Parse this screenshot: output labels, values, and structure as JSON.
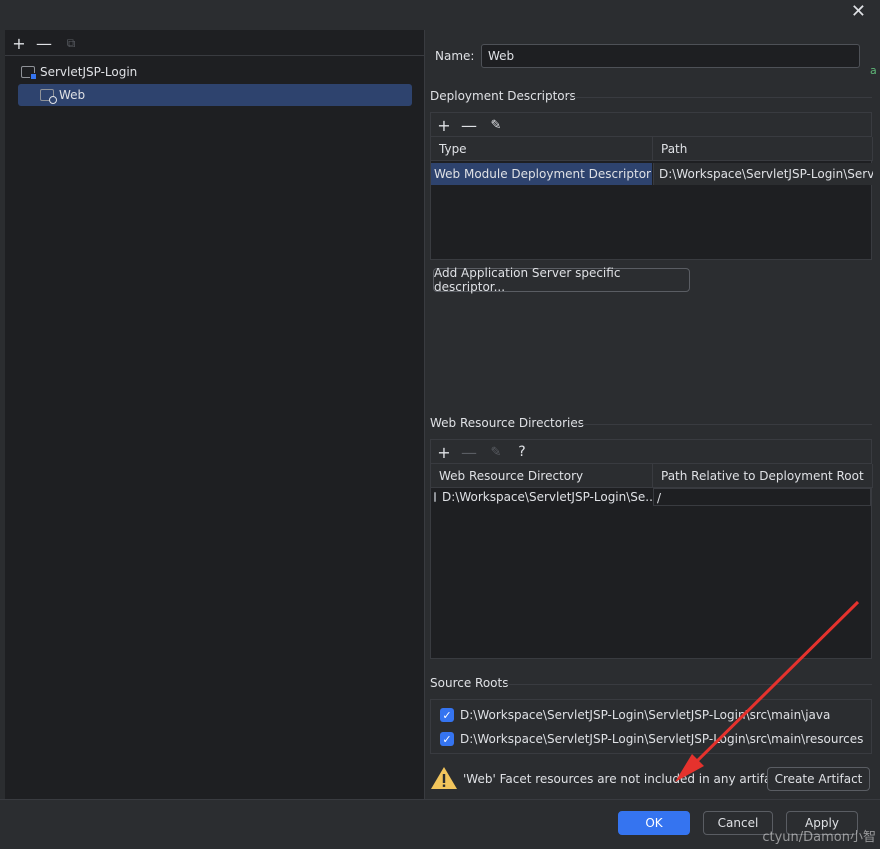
{
  "window": {
    "close_glyph": "✕"
  },
  "left_toolbar": {
    "add": "+",
    "remove": "—",
    "copy": "⧉"
  },
  "tree": [
    {
      "label": "ServletJSP-Login",
      "icon": "module-icon"
    },
    {
      "label": "Web",
      "icon": "web-facet-icon",
      "selected": true
    }
  ],
  "name_label": "Name:",
  "name_value": "Web",
  "deployment": {
    "title": "Deployment Descriptors",
    "toolbar": {
      "add": "+",
      "remove": "—",
      "edit": "✎"
    },
    "columns": [
      "Type",
      "Path"
    ],
    "rows": [
      {
        "type": "Web Module Deployment Descriptor",
        "path": "D:\\Workspace\\ServletJSP-Login\\ServletJ"
      }
    ],
    "add_button": "Add Application Server specific descriptor..."
  },
  "web_resources": {
    "title": "Web Resource Directories",
    "toolbar": {
      "add": "+",
      "remove": "—",
      "edit": "✎",
      "help": "?"
    },
    "columns": [
      "Web Resource Directory",
      "Path Relative to Deployment Root"
    ],
    "rows": [
      {
        "dir": "D:\\Workspace\\ServletJSP-Login\\Se...",
        "path": "/"
      }
    ]
  },
  "source_roots": {
    "title": "Source Roots",
    "items": [
      {
        "path": "D:\\Workspace\\ServletJSP-Login\\ServletJSP-Login\\src\\main\\java",
        "checked": true
      },
      {
        "path": "D:\\Workspace\\ServletJSP-Login\\ServletJSP-Login\\src\\main\\resources",
        "checked": true
      }
    ]
  },
  "warning": {
    "text": "'Web' Facet resources are not included in any artifacts",
    "button": "Create Artifact"
  },
  "buttons": {
    "ok": "OK",
    "cancel": "Cancel",
    "apply": "Apply"
  },
  "watermark": "ctyun/Damon小智",
  "edge_fragment": "a",
  "colors": {
    "accent": "#3574f0",
    "selection": "#2e436e",
    "warning": "#f2c55c",
    "arrow": "#e5322d"
  }
}
